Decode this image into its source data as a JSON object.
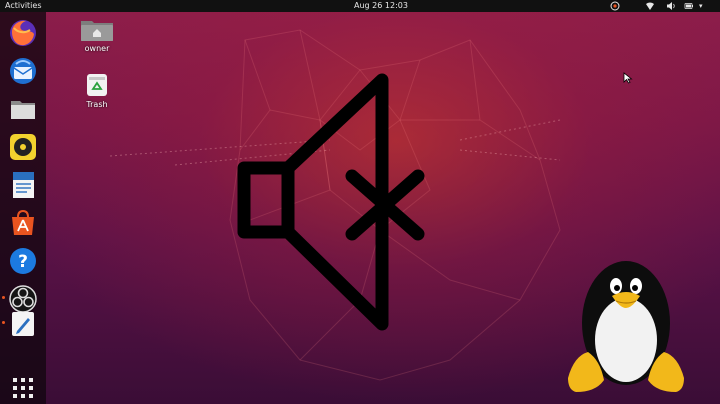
{
  "topbar": {
    "activities_label": "Activities",
    "clock_text": "Aug 26  12:03",
    "tray_icons": [
      "accessibility-icon",
      "network-icon",
      "volume-icon",
      "battery-icon"
    ]
  },
  "dock": {
    "items": [
      {
        "name": "firefox-icon",
        "running": false
      },
      {
        "name": "thunderbird-icon",
        "running": false
      },
      {
        "name": "files-icon",
        "running": false
      },
      {
        "name": "rhythmbox-icon",
        "running": false
      },
      {
        "name": "libreoffice-writer-icon",
        "running": false
      },
      {
        "name": "software-center-icon",
        "running": false
      },
      {
        "name": "help-icon",
        "running": false
      },
      {
        "name": "obs-studio-icon",
        "running": true
      },
      {
        "name": "text-editor-icon",
        "running": true
      }
    ],
    "show_apps": "app-grid-icon"
  },
  "desktop": {
    "icons": [
      {
        "name": "home-folder-icon",
        "label": "owner"
      },
      {
        "name": "trash-icon",
        "label": "Trash"
      }
    ]
  },
  "overlay": {
    "mute_symbol": "speaker-muted-icon",
    "mascot": "tux-penguin"
  },
  "colors": {
    "topbar": "#111111",
    "wallpaper_top": "#8e1e4b",
    "wallpaper_bottom": "#3a0d36",
    "accent": "#e95420",
    "mute_stroke": "#000000"
  }
}
